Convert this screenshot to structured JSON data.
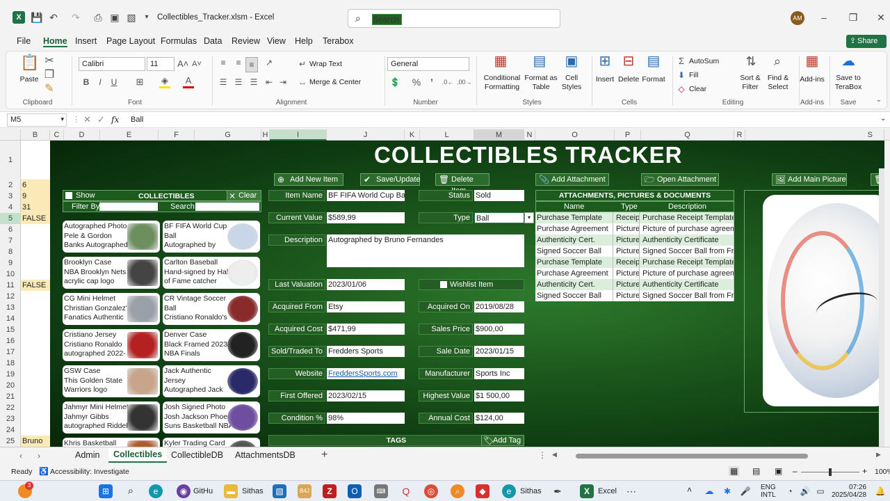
{
  "window": {
    "filename": "Collectibles_Tracker.xlsm - Excel",
    "search_placeholder": "Search",
    "user_initials": "AM",
    "share_label": "Share"
  },
  "menu": [
    "File",
    "Home",
    "Insert",
    "Page Layout",
    "Formulas",
    "Data",
    "Review",
    "View",
    "Help",
    "Terabox"
  ],
  "ribbon": {
    "paste": "Paste",
    "clipboard": "Clipboard",
    "font_name": "Calibri",
    "font_size": "11",
    "font": "Font",
    "wrap_text": "Wrap Text",
    "merge_center": "Merge & Center",
    "alignment": "Alignment",
    "number_format": "General",
    "number": "Number",
    "conditional_formatting": [
      "Conditional",
      "Formatting"
    ],
    "format_as_table": [
      "Format as",
      "Table"
    ],
    "cell_styles": [
      "Cell",
      "Styles"
    ],
    "styles": "Styles",
    "insert": "Insert",
    "delete": "Delete",
    "format": "Format",
    "cells": "Cells",
    "autosum": "AutoSum",
    "fill": "Fill",
    "clear": "Clear",
    "sort_filter": [
      "Sort &",
      "Filter"
    ],
    "find_select": [
      "Find &",
      "Select"
    ],
    "editing": "Editing",
    "add_ins": "Add-ins",
    "save_terabox": [
      "Save to",
      "TeraBox"
    ],
    "save": "Save"
  },
  "formula_bar": {
    "name_box": "M5",
    "content": "Ball",
    "fx": "fx"
  },
  "columns": [
    "B",
    "C",
    "D",
    "E",
    "F",
    "G",
    "H",
    "I",
    "J",
    "K",
    "L",
    "M",
    "N",
    "O",
    "P",
    "Q",
    "R",
    "S"
  ],
  "rows": [
    "1",
    "2",
    "3",
    "4",
    "5",
    "6",
    "7",
    "8",
    "9",
    "10",
    "11",
    "12",
    "13",
    "14",
    "15",
    "16",
    "17",
    "18",
    "19",
    "20",
    "21",
    "22",
    "23",
    "24",
    "25"
  ],
  "col_b": {
    "r2": "6",
    "r3": "9",
    "r4": "31",
    "r5": "FALSE",
    "r11": "FALSE",
    "r25": "Bruno Fe"
  },
  "sheet": {
    "title": "COLLECTIBLES TRACKER",
    "buttons": {
      "add_new_item": "Add New Item",
      "save_update": "Save/Update",
      "delete_item": "Delete Item",
      "add_attachment": "Add Attachment",
      "open_attachment": "Open Attachment",
      "add_main_picture": "Add Main Picture",
      "add_tag": "Add Tag",
      "clear": "Clear"
    },
    "collectibles_header": "COLLECTIBLES",
    "show_label": "Show",
    "filter_by": "Filter By",
    "search": "Search",
    "cards_left": [
      [
        "Autographed Photo",
        "Pele & Gordon",
        "Banks Autographed"
      ],
      [
        "Brooklyn Case",
        "NBA Brooklyn Nets",
        "acrylic cap logo"
      ],
      [
        "CG Mini Helmet",
        "Christian Gonzalez's",
        "Fanatics Authentic"
      ],
      [
        "Cristiano Jersey",
        "Cristiano Ronaldo",
        "autographed 2022-"
      ],
      [
        "GSW Case",
        "This Golden State",
        "Warriors logo"
      ],
      [
        "Jahmyr Mini Helmet",
        "Jahmyr Gibbs",
        "autographed Riddell"
      ],
      [
        "Khris Basketball",
        "",
        ""
      ]
    ],
    "cards_right": [
      [
        "BF FIFA World Cup",
        "Ball",
        "Autographed by"
      ],
      [
        "Carlton Baseball",
        "Hand-signed by Hall",
        "of Fame catcher"
      ],
      [
        "CR Vintage Soccer",
        "Ball",
        "Cristiano Ronaldo's"
      ],
      [
        "Denver Case",
        "Black Framed 2023",
        "NBA Finals"
      ],
      [
        "Jack  Authentic",
        "Jersey",
        "Autographed Jack"
      ],
      [
        "Josh Signed Photo",
        "Josh Jackson Phoeni",
        "Suns Basketball NBA"
      ],
      [
        "Kyler Trading Card",
        "",
        ""
      ]
    ],
    "form": {
      "item_name_label": "Item Name",
      "item_name": "BF FIFA World Cup Ball",
      "status_label": "Status",
      "status": "Sold",
      "current_value_label": "Current Value",
      "current_value": "$589,99",
      "type_label": "Type",
      "type": "Ball",
      "description_label": "Description",
      "description": "Autographed by Bruno Fernandes",
      "last_valuation_label": "Last Valuation",
      "last_valuation": "2023/01/06",
      "wishlist_label": "Wishlist Item",
      "acquired_from_label": "Acquired From",
      "acquired_from": "Etsy",
      "acquired_on_label": "Acquired On",
      "acquired_on": "2019/08/28",
      "acquired_cost_label": "Acquired Cost",
      "acquired_cost": "$471,99",
      "sales_price_label": "Sales Price",
      "sales_price": "$900,00",
      "sold_traded_label": "Sold/Traded To",
      "sold_traded": "Fredders Sports",
      "sale_date_label": "Sale Date",
      "sale_date": "2023/01/15",
      "website_label": "Website",
      "website": "FreddersSports.com",
      "manufacturer_label": "Manufacturer",
      "manufacturer": "Sports Inc",
      "first_offered_label": "First Offered",
      "first_offered": "2023/02/15",
      "highest_value_label": "Highest Value",
      "highest_value": "$1 500,00",
      "condition_label": "Condition %",
      "condition": "98%",
      "annual_cost_label": "Annual Cost",
      "annual_cost": "$124,00",
      "tags_label": "TAGS"
    },
    "attachments": {
      "header": "ATTACHMENTS, PICTURES & DOCUMENTS",
      "col_name": "Name",
      "col_type": "Type",
      "col_desc": "Description",
      "rows": [
        [
          "Purchase Template",
          "Receipt",
          "Purchase Receipt Template"
        ],
        [
          "Purchase Agreement",
          "Picture",
          "Picture of purchase agreem"
        ],
        [
          "Authenticity Cert.",
          "Picture",
          "Authenticity Certificate"
        ],
        [
          "Signed Soccer Ball",
          "Picture",
          "Signed Soccer Ball from Fre"
        ],
        [
          "Purchase Template",
          "Receipt",
          "Purchase Receipt Template"
        ],
        [
          "Purchase Agreement",
          "Picture",
          "Picture of purchase agreem"
        ],
        [
          "Authenticity Cert.",
          "Picture",
          "Authenticity Certificate"
        ],
        [
          "Signed Soccer Ball",
          "Picture",
          "Signed Soccer Ball from Fre"
        ]
      ]
    }
  },
  "tabs": [
    "Admin",
    "Collectibles",
    "CollectibleDB",
    "AttachmentsDB"
  ],
  "status": {
    "ready": "Ready",
    "accessibility": "Accessibility: Investigate",
    "zoom": "100%"
  },
  "taskbar": {
    "github": "GitHu",
    "sithas1": "Sithas",
    "sithas2": "Sithas",
    "excel": "Excel",
    "lang1": "ENG",
    "lang2": "INTL",
    "time": "07:26",
    "date": "2025/04/28",
    "notif": "3"
  },
  "colors": {
    "excel_green": "#217346",
    "sheet_dark": "#0f3d12",
    "label_green": "#245e24",
    "row_alt": "#dbeedb"
  }
}
